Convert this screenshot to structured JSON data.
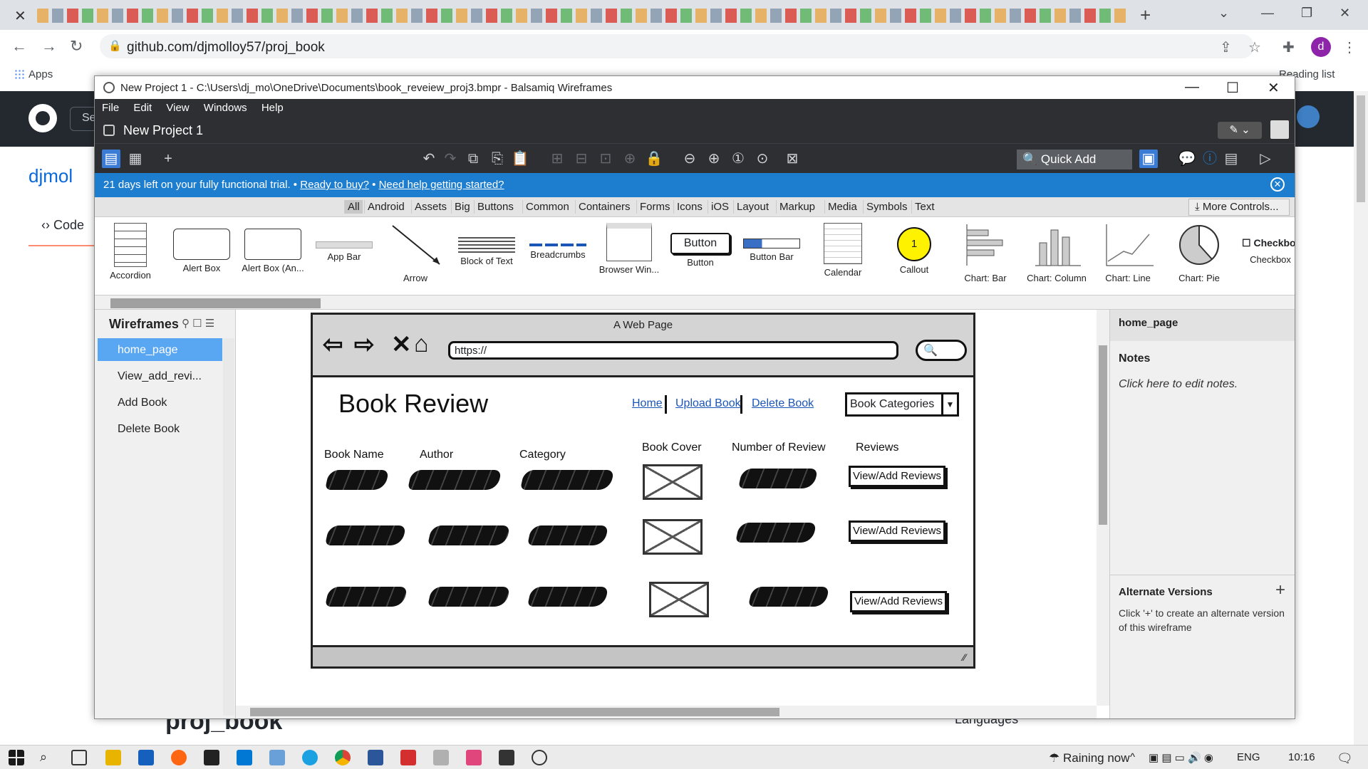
{
  "browser": {
    "url": "github.com/djmolloy57/proj_book",
    "apps_label": "Apps",
    "reading_list": "Reading list",
    "profile_initial": "d"
  },
  "github": {
    "search_fragment": "Se",
    "owner_fragment": "djmol",
    "tab_code": "Code",
    "repo_heading": "proj_book",
    "languages_heading": "Languages"
  },
  "balsamiq": {
    "window_title": "New Project 1 - C:\\Users\\dj_mo\\OneDrive\\Documents\\book_reveiew_proj3.bmpr - Balsamiq Wireframes",
    "menu": [
      "File",
      "Edit",
      "View",
      "Windows",
      "Help"
    ],
    "project_name": "New Project 1",
    "quick_add": "Quick Add",
    "trial": {
      "message": "21 days left on your fully functional trial.",
      "ready": "Ready to buy?",
      "help": "Need help getting started?"
    },
    "categories": [
      "All",
      "Android",
      "Assets",
      "Big",
      "Buttons",
      "Common",
      "Containers",
      "Forms",
      "Icons",
      "iOS",
      "Layout",
      "Markup",
      "Media",
      "Symbols",
      "Text"
    ],
    "more_controls": "More Controls...",
    "gallery": [
      "Accordion",
      "Alert Box",
      "Alert Box (An...",
      "App Bar",
      "Arrow",
      "Block of Text",
      "Breadcrumbs",
      "Browser Win...",
      "Button",
      "Button Bar",
      "Calendar",
      "Callout",
      "Chart: Bar",
      "Chart: Column",
      "Chart: Line",
      "Chart: Pie",
      "Checkbox"
    ],
    "gallery_button_text": "Button",
    "gallery_callout_num": "1",
    "gallery_checkbox_text": "Checkbo",
    "wireframes_heading": "Wireframes",
    "wireframes": [
      "home_page",
      "View_add_revi...",
      "Add Book",
      "Delete Book"
    ],
    "mockup": {
      "window_title": "A Web Page",
      "url": "https://",
      "brand": "Book Review",
      "nav": [
        "Home",
        "Upload Book",
        "Delete Book"
      ],
      "dropdown": "Book Categories",
      "columns": [
        "Book Name",
        "Author",
        "Category",
        "Book Cover",
        "Number of Review",
        "Reviews"
      ],
      "row_button": "View/Add Reviews",
      "row_count": 3
    },
    "inspector": {
      "page": "home_page",
      "notes_heading": "Notes",
      "notes_placeholder": "Click here to edit notes.",
      "alt_heading": "Alternate Versions",
      "alt_text": "Click '+' to create an alternate version of this wireframe"
    }
  },
  "taskbar": {
    "weather": "Raining now",
    "lang": "ENG",
    "time": "10:16"
  }
}
